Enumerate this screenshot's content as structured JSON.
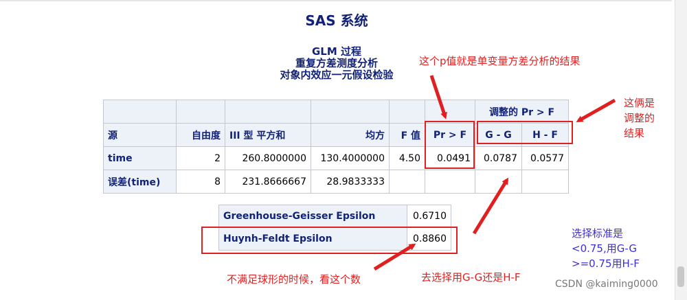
{
  "titles": {
    "system": "SAS 系统",
    "proc": "GLM 过程",
    "sub1": "重复方差测度分析",
    "sub2": "对象内效应一元假设检验"
  },
  "anova": {
    "adjusted_group": "调整的 Pr > F",
    "headers": [
      "源",
      "自由度",
      "III 型 平方和",
      "均方",
      "F 值",
      "Pr > F",
      "G - G",
      "H - F"
    ],
    "rows": [
      {
        "source": "time",
        "df": "2",
        "ss": "260.8000000",
        "ms": "130.4000000",
        "f": "4.50",
        "p": "0.0491",
        "gg": "0.0787",
        "hf": "0.0577"
      },
      {
        "source": "误差(time)",
        "df": "8",
        "ss": "231.8666667",
        "ms": "28.9833333",
        "f": "",
        "p": "",
        "gg": "",
        "hf": ""
      }
    ]
  },
  "epsilon": {
    "rows": [
      {
        "label": "Greenhouse-Geisser Epsilon",
        "value": "0.6710"
      },
      {
        "label": "Huynh-Feldt Epsilon",
        "value": "0.8860"
      }
    ]
  },
  "annotations": {
    "p_value_note": "这个p值就是单变量方差分析的结果",
    "adjusted_note": [
      "这俩是",
      "调整的",
      "结果"
    ],
    "criteria_note": [
      "选择标准是",
      "<0.75,用G-G",
      ">=0.75用H-F"
    ],
    "sphericity_note": "不满足球形的时候，看这个数",
    "choose_note": "去选择用G-G还是H-F"
  },
  "watermark": "CSDN @kaiming0000",
  "colors": {
    "sas_blue": "#112277",
    "header_bg": "#edf2f9",
    "annotation_red": "#e02020",
    "annotation_purple": "#3d2fd6"
  }
}
